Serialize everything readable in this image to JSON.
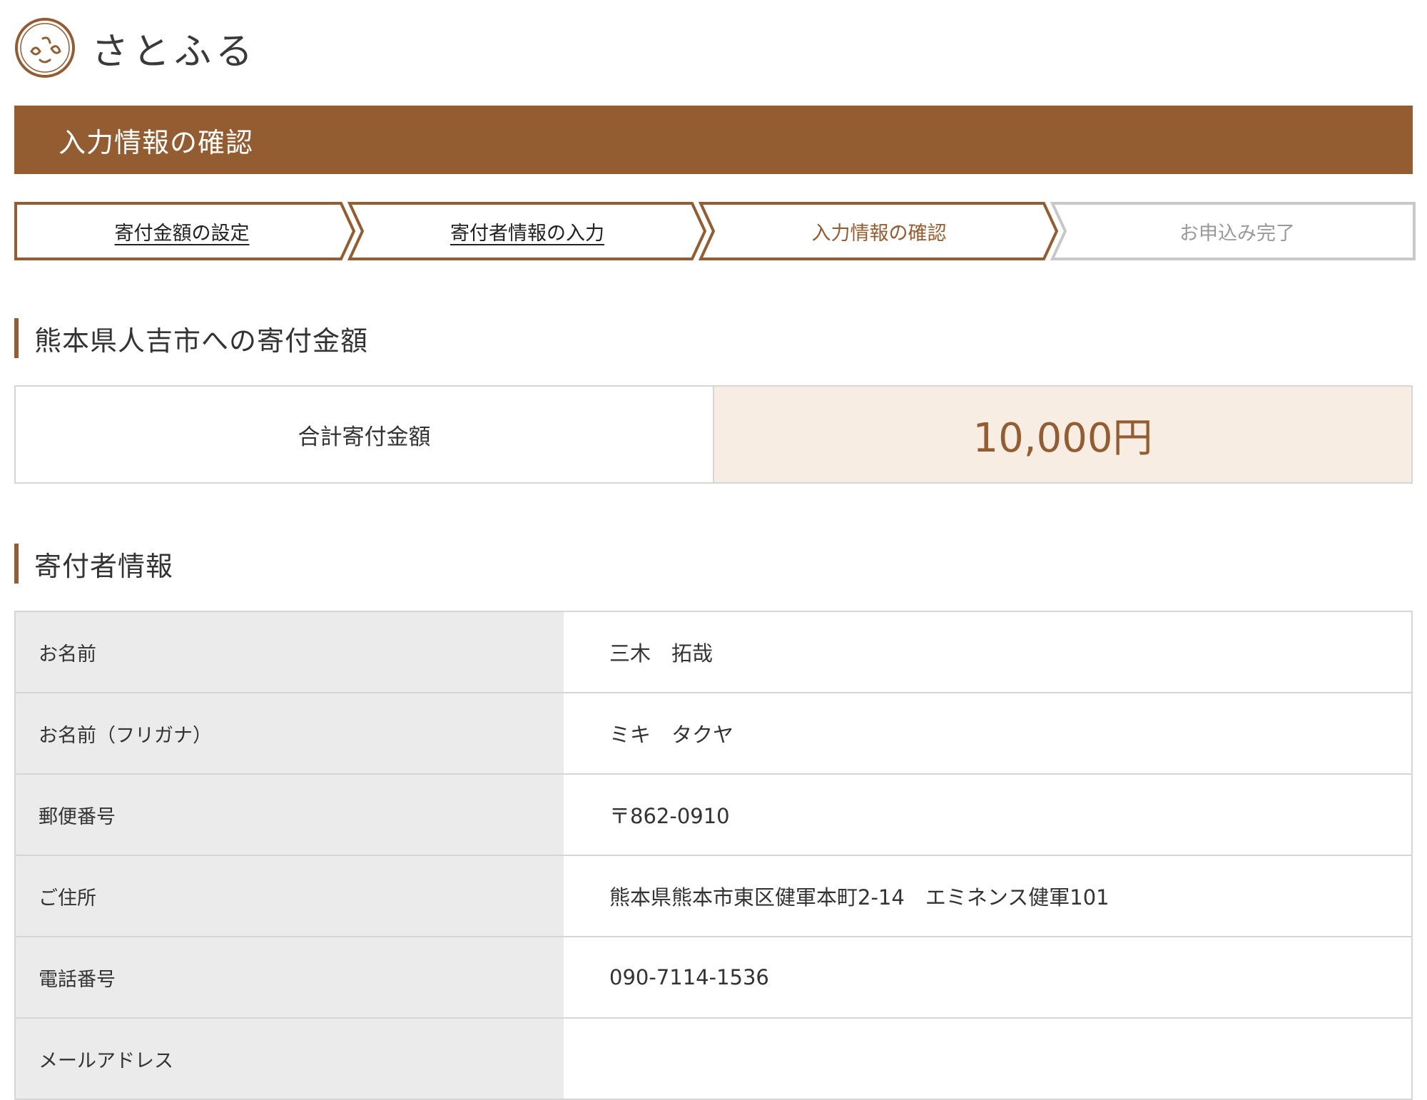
{
  "header": {
    "logo_text": "さとふる"
  },
  "page": {
    "title": "入力情報の確認"
  },
  "steps": [
    {
      "label": "寄付金額の設定",
      "state": "done"
    },
    {
      "label": "寄付者情報の入力",
      "state": "done"
    },
    {
      "label": "入力情報の確認",
      "state": "current"
    },
    {
      "label": "お申込み完了",
      "state": "todo"
    }
  ],
  "donation": {
    "heading": "熊本県人吉市への寄付金額",
    "total_label": "合計寄付金額",
    "total_value": "10,000円"
  },
  "donor": {
    "heading": "寄付者情報",
    "rows": [
      {
        "label": "お名前",
        "value": "三木　拓哉"
      },
      {
        "label": "お名前（フリガナ）",
        "value": "ミキ　タクヤ"
      },
      {
        "label": "郵便番号",
        "value": "〒862-0910"
      },
      {
        "label": "ご住所",
        "value": "熊本県熊本市東区健軍本町2-14　エミネンス健軍101"
      },
      {
        "label": "電話番号",
        "value": "090-7114-1536"
      },
      {
        "label": "メールアドレス",
        "value": ""
      }
    ]
  },
  "colors": {
    "brand": "#935c31",
    "highlight_bg": "#f7ede3",
    "label_bg": "#ebebeb",
    "border": "#d6d6d6",
    "inactive_step": "#c8c8c8"
  }
}
